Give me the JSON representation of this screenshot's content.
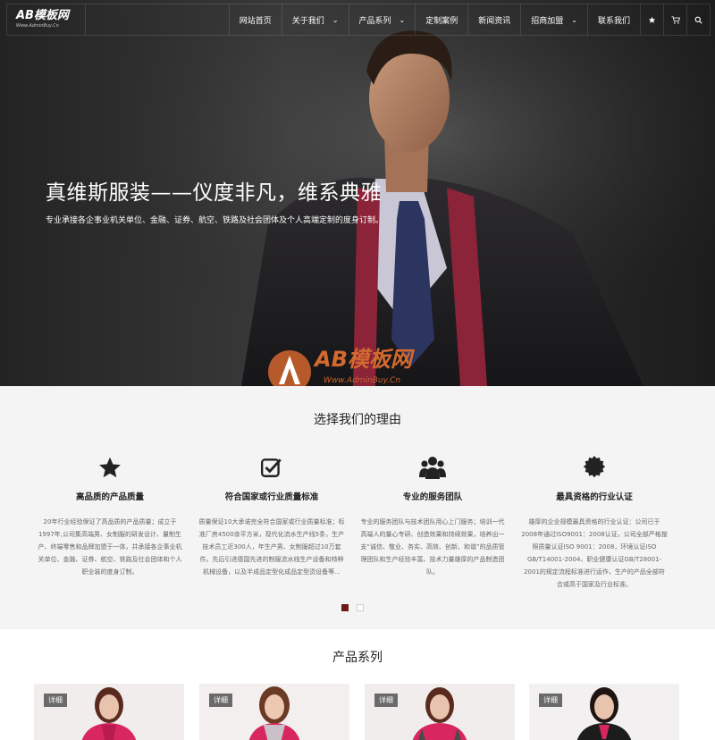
{
  "header": {
    "logo_main": "AB模板网",
    "logo_sub": "Www.AdminBuy.Cn",
    "nav": [
      {
        "label": "网站首页"
      },
      {
        "label": "关于我们"
      },
      {
        "label": "产品系列"
      },
      {
        "label": "定制案例"
      },
      {
        "label": "新闻资讯"
      },
      {
        "label": "招商加盟"
      },
      {
        "label": "联系我们"
      }
    ],
    "icons": [
      "star-icon",
      "cart-icon",
      "search-icon"
    ]
  },
  "hero": {
    "title": "真维斯服装——仪度非凡，维系典雅",
    "subtitle": "专业承接各企事业机关单位、金融、证券、航空、铁路及社会团体及个人高端定制的度身订制。"
  },
  "watermark": {
    "main": "AB模板网",
    "sub": "Www.AdminBuy.Cn"
  },
  "why": {
    "title": "选择我们的理由",
    "features": [
      {
        "icon": "star-icon",
        "name": "高品质的产品质量",
        "desc": "20年行业经验保证了高品质的产品质量；成立于1997年,公司集高端男、女制服的研发设计、量制生产、终端零售和品牌加盟于一体，并承接各企事业机关单位、金融、证券、航空、铁路及社会团体和个人职业装的度身订制。"
      },
      {
        "icon": "checkbox-icon",
        "name": "符合国家或行业质量标准",
        "desc": "质量保证10大承诺完全符合国家或行业质量标准；标准厂房4500余平方米，现代化流水生产线5条，生产技术员工近300人，年生产男、女制服超过10万套件。先后引进德国先进的制服流水线生产设备和特种机械设备，以及半成品定型化成品定型烫设备等..."
      },
      {
        "icon": "team-icon",
        "name": "专业的服务团队",
        "desc": "专业的服务团队与技术团队用心上门服务；培训一代高端人的量心专研、创造效果和持续效果，培养出一支“诚信、敬业、务实、高效、创新、和谐”的品质管理团队和生产经验丰富、技术力量雄厚的产品制造团队。"
      },
      {
        "icon": "badge-icon",
        "name": "最具资格的行业认证",
        "desc": "雄厚的企业规模最具资格的行业认证：公司已于2008年通过ISO9001：2008认证，公司全部严格按照质量认证ISO 9001：2008，环境认证ISO GB/T14001-2004、职业健康认证GB/T28001-2001的规定流程标准进行运作，生产的产品全部符合或高于国家及行业标准。"
      }
    ]
  },
  "products": {
    "title": "产品系列",
    "cards": [
      {
        "tag": "详细"
      },
      {
        "tag": "详细"
      },
      {
        "tag": "详细"
      },
      {
        "tag": "详细"
      }
    ]
  }
}
